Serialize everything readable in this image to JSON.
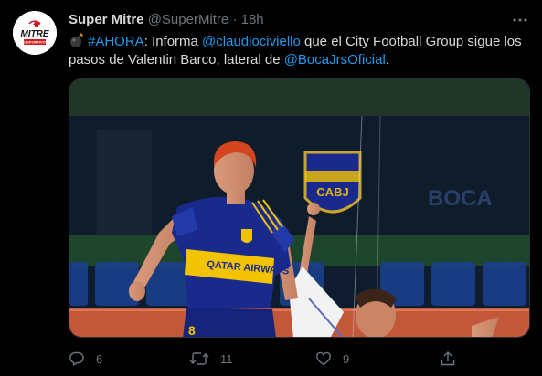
{
  "colors": {
    "background": "#000000",
    "text": "#d9d9d9",
    "muted": "#6e767d",
    "link": "#1d9bf0",
    "boca_blue": "#1a2a8c",
    "boca_gold": "#f2c400",
    "mitre_red": "#d3171f"
  },
  "author": {
    "avatar_icon": "mitre-logo-icon",
    "avatar_text": "MITRE",
    "avatar_subtext": "DEPORTIVO",
    "display_name": "Super Mitre",
    "handle": "@SuperMitre",
    "separator": "·",
    "time": "18h"
  },
  "more_icon": "more-horizontal-icon",
  "tweet": {
    "emoji_icon": "bomb-icon",
    "hashtag": "#AHORA",
    "text_1": ": Informa ",
    "mention_1": "@claudiociviello",
    "text_2": " que el City Football Group sigue los pasos de Valentin Barco, lateral de ",
    "mention_2": "@BocaJrsOficial",
    "text_3": "."
  },
  "media": {
    "description_icon": "photo-icon",
    "sponsor_text": "QATAR AIRWAYS",
    "crest_text": "CABJ",
    "banner_text": "BOCA",
    "jersey_number": "8"
  },
  "actions": {
    "reply_icon": "reply-icon",
    "reply_count": "6",
    "retweet_icon": "retweet-icon",
    "retweet_count": "11",
    "like_icon": "heart-icon",
    "like_count": "9",
    "share_icon": "share-icon"
  }
}
